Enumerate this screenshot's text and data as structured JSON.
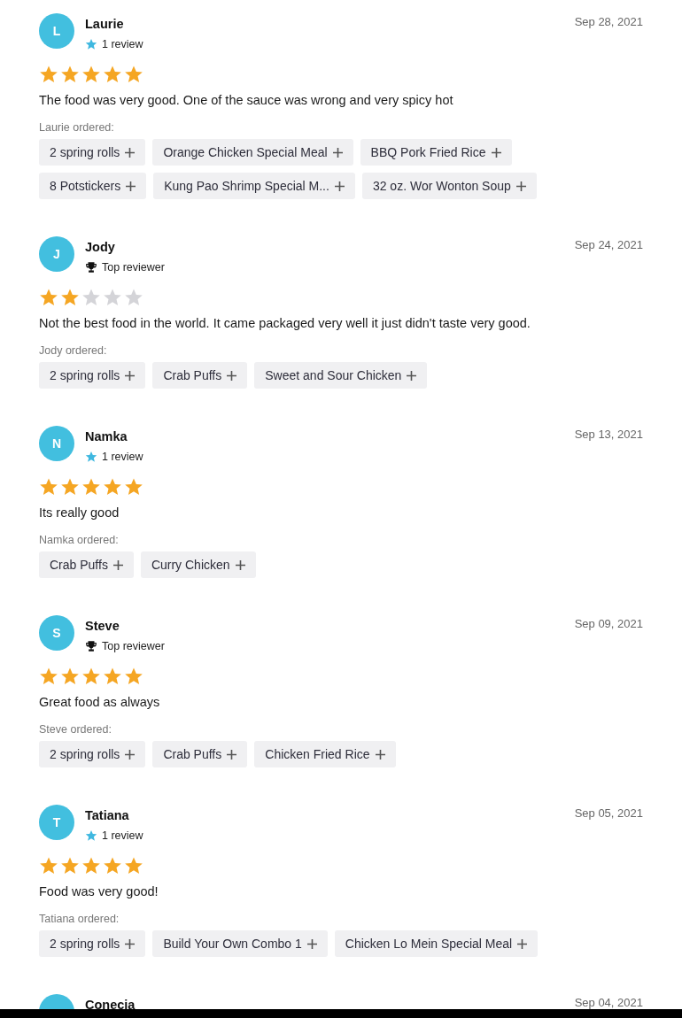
{
  "reviews": [
    {
      "initial": "L",
      "name": "Laurie",
      "badge": {
        "kind": "reviews",
        "text": "1 review"
      },
      "date": "Sep 28, 2021",
      "stars": 5,
      "text": "The food was very good. One of the sauce was wrong and very spicy hot",
      "ordered_label": "Laurie ordered:",
      "items": [
        "2 spring rolls",
        "Orange Chicken Special Meal",
        "BBQ Pork Fried Rice",
        "8 Potstickers",
        "Kung Pao Shrimp Special M...",
        "32 oz. Wor Wonton Soup"
      ]
    },
    {
      "initial": "J",
      "name": "Jody",
      "badge": {
        "kind": "top",
        "text": "Top reviewer"
      },
      "date": "Sep 24, 2021",
      "stars": 2,
      "text": "Not the best food in the world. It came packaged very well it just didn't taste very good.",
      "ordered_label": "Jody ordered:",
      "items": [
        "2 spring rolls",
        "Crab Puffs",
        "Sweet and Sour Chicken"
      ]
    },
    {
      "initial": "N",
      "name": "Namka",
      "badge": {
        "kind": "reviews",
        "text": "1 review"
      },
      "date": "Sep 13, 2021",
      "stars": 5,
      "text": "Its really good",
      "ordered_label": "Namka ordered:",
      "items": [
        "Crab Puffs",
        "Curry Chicken"
      ]
    },
    {
      "initial": "S",
      "name": "Steve",
      "badge": {
        "kind": "top",
        "text": "Top reviewer"
      },
      "date": "Sep 09, 2021",
      "stars": 5,
      "text": "Great food as always",
      "ordered_label": "Steve ordered:",
      "items": [
        "2 spring rolls",
        "Crab Puffs",
        "Chicken Fried Rice"
      ]
    },
    {
      "initial": "T",
      "name": "Tatiana",
      "badge": {
        "kind": "reviews",
        "text": "1 review"
      },
      "date": "Sep 05, 2021",
      "stars": 5,
      "text": "Food was very good!",
      "ordered_label": "Tatiana ordered:",
      "items": [
        "2 spring rolls",
        "Build Your Own Combo 1",
        "Chicken Lo Mein Special Meal"
      ]
    },
    {
      "name": "Conecia",
      "date": "Sep 04, 2021"
    }
  ]
}
